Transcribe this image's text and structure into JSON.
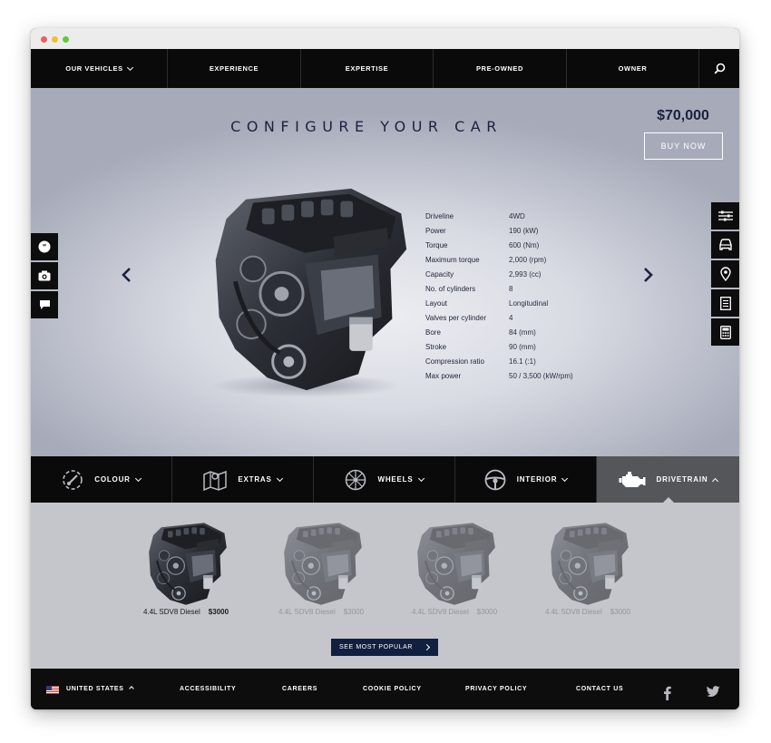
{
  "nav": {
    "items": [
      {
        "label": "OUR VEHICLES",
        "has_dropdown": true
      },
      {
        "label": "EXPERIENCE"
      },
      {
        "label": "EXPERTISE"
      },
      {
        "label": "PRE-OWNED"
      },
      {
        "label": "OWNER"
      }
    ],
    "search_icon": "search-icon"
  },
  "hero": {
    "title": "CONFIGURE YOUR CAR",
    "price": "$70,000",
    "buy_label": "BUY NOW"
  },
  "specs": [
    {
      "label": "Driveline",
      "value": "4WD"
    },
    {
      "label": "Power",
      "value": "190 (kW)"
    },
    {
      "label": "Torque",
      "value": "600 (Nm)"
    },
    {
      "label": "Maximum torque",
      "value": "2,000 (rpm)"
    },
    {
      "label": "Capacity",
      "value": "2,993 (cc)"
    },
    {
      "label": "No. of cylinders",
      "value": "8"
    },
    {
      "label": "Layout",
      "value": "Longitudinal"
    },
    {
      "label": "Valves per cylinder",
      "value": "4"
    },
    {
      "label": "Bore",
      "value": "84 (mm)"
    },
    {
      "label": "Stroke",
      "value": "90 (mm)"
    },
    {
      "label": "Compression ratio",
      "value": "16.1 (:1)"
    },
    {
      "label": "Max power",
      "value": "50 / 3,500 (kW/rpm)"
    }
  ],
  "side_left_icons": [
    "quote-icon",
    "camera-icon",
    "chat-icon"
  ],
  "side_right_icons": [
    "sliders-icon",
    "car-front-icon",
    "location-pin-icon",
    "document-icon",
    "calculator-icon"
  ],
  "tabs": [
    {
      "label": "COLOUR",
      "icon": "paint-palette-icon"
    },
    {
      "label": "EXTRAS",
      "icon": "map-icon"
    },
    {
      "label": "WHEELS",
      "icon": "wheel-icon"
    },
    {
      "label": "INTERIOR",
      "icon": "steering-wheel-icon"
    },
    {
      "label": "DRIVETRAIN",
      "icon": "engine-icon",
      "active": true
    }
  ],
  "options": [
    {
      "name": "4.4L SDV8 Diesel",
      "price": "$3000",
      "selected": true
    },
    {
      "name": "4.4L SDV8 Diesel",
      "price": "$3000",
      "selected": false
    },
    {
      "name": "4.4L SDV8 Diesel",
      "price": "$3000",
      "selected": false
    },
    {
      "name": "4.4L SDV8 Diesel",
      "price": "$3000",
      "selected": false
    }
  ],
  "popular_label": "SEE MOST POPULAR",
  "footer": {
    "country": "UNITED STATES",
    "links": [
      "ACCESSIBILITY",
      "CAREERS",
      "COOKIE POLICY",
      "PRIVACY POLICY",
      "CONTACT US"
    ],
    "social": [
      "facebook-icon",
      "twitter-icon"
    ]
  },
  "colors": {
    "nav_bg": "#0a0a0a",
    "accent_navy": "#11203e",
    "active_tab": "#555659",
    "options_bg": "#c4c6cc"
  }
}
